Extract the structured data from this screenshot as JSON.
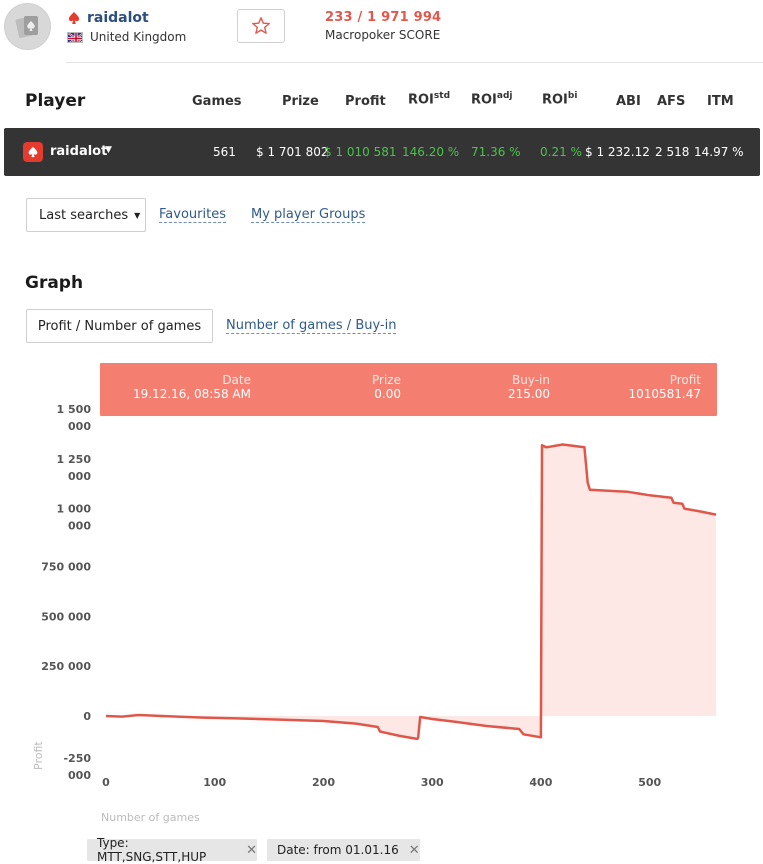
{
  "header": {
    "player_name": "raidalot",
    "country": "United Kingdom",
    "score": "233 / 1 971 994",
    "score_label": "Macropoker SCORE"
  },
  "player_table": {
    "title": "Player",
    "columns": {
      "games": "Games",
      "prize": "Prize",
      "profit": "Profit",
      "roi_std": "ROI",
      "roi_std_sup": "std",
      "roi_adj": "ROI",
      "roi_adj_sup": "adj",
      "roi_bi": "ROI",
      "roi_bi_sup": "bi",
      "abi": "ABI",
      "afs": "AFS",
      "itm": "ITM"
    },
    "row": {
      "name": "raidalot",
      "games": "561",
      "prize": "$ 1 701 802",
      "profit": "$ 1 010 581",
      "roi_std": "146.20 %",
      "roi_adj": "71.36 %",
      "roi_bi": "0.21 %",
      "abi": "$ 1 232.12",
      "afs": "2 518",
      "itm": "14.97 %"
    }
  },
  "searches": {
    "last_searches": "Last searches",
    "favourites": "Favourites",
    "groups": "My player Groups"
  },
  "graph": {
    "title": "Graph",
    "btn_profit": "Profit / Number of games",
    "link_games_buyin": "Number of games / Buy-in",
    "tooltip": {
      "date_h": "Date",
      "date_v": "19.12.16, 08:58 AM",
      "prize_h": "Prize",
      "prize_v": "0.00",
      "buyin_h": "Buy-in",
      "buyin_v": "215.00",
      "profit_h": "Profit",
      "profit_v": "1010581.47"
    }
  },
  "chart_data": {
    "type": "area",
    "xlabel": "Number of games",
    "ylabel": "Profit",
    "xlim": [
      0,
      561
    ],
    "ylim": [
      -250000,
      1500000
    ],
    "xticks": [
      "0",
      "100",
      "200",
      "300",
      "400",
      "500"
    ],
    "yticks": [
      {
        "value": 1500000,
        "l1": "1 500",
        "l2": "000"
      },
      {
        "value": 1250000,
        "l1": "1 250",
        "l2": "000"
      },
      {
        "value": 1000000,
        "l1": "1 000",
        "l2": "000"
      },
      {
        "value": 750000,
        "l1": "750 000",
        "l2": ""
      },
      {
        "value": 500000,
        "l1": "500 000",
        "l2": ""
      },
      {
        "value": 250000,
        "l1": "250 000",
        "l2": ""
      },
      {
        "value": 0,
        "l1": "0",
        "l2": ""
      },
      {
        "value": -250000,
        "l1": "-250",
        "l2": "000"
      }
    ],
    "series": [
      {
        "color": "#e0574a",
        "x": [
          0,
          15,
          30,
          60,
          90,
          120,
          160,
          200,
          230,
          250,
          252,
          270,
          286,
          287,
          289,
          300,
          320,
          350,
          380,
          384,
          400,
          401,
          405,
          420,
          440,
          443,
          445,
          470,
          480,
          500,
          520,
          522,
          530,
          532,
          545,
          561
        ],
        "y": [
          0,
          -3000,
          5000,
          -2000,
          -8000,
          -12000,
          -18000,
          -25000,
          -38000,
          -55000,
          -78000,
          -100000,
          -115000,
          -110000,
          -5000,
          -15000,
          -28000,
          -50000,
          -65000,
          -92000,
          -107000,
          1358000,
          1348000,
          1362000,
          1348000,
          1170000,
          1135000,
          1128000,
          1125000,
          1107000,
          1095000,
          1070000,
          1065000,
          1040000,
          1028000,
          1010581
        ]
      }
    ]
  },
  "filters": {
    "type": "Type: MTT,SNG,STT,HUP",
    "date": "Date: from 01.01.16"
  }
}
